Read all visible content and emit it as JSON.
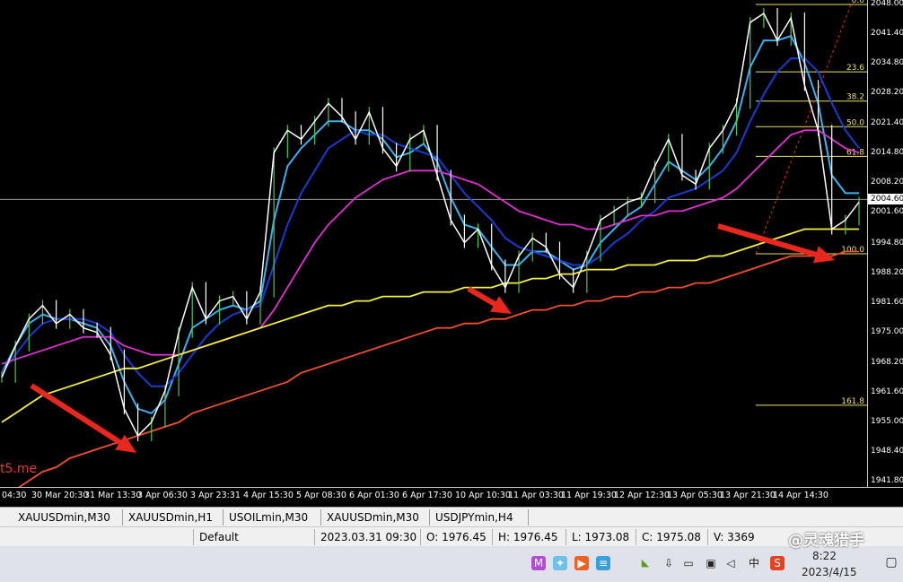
{
  "chart_data": {
    "type": "line",
    "symbol": "XAUUSDmin,M30",
    "price_ticks": [
      "2048.00",
      "2041.40",
      "2034.80",
      "2028.20",
      "2021.40",
      "2014.80",
      "2008.20",
      "2001.60",
      "1994.80",
      "1988.20",
      "1981.60",
      "1975.00",
      "1968.20",
      "1961.60",
      "1955.00",
      "1948.40",
      "1941.80"
    ],
    "current_price": "2004.60",
    "ylim": [
      1941.8,
      2048.0
    ],
    "time_ticks": [
      "04:30",
      "30 Mar 20:30",
      "31 Mar 13:30",
      "3 Apr 06:30",
      "3 Apr 23:31",
      "4 Apr 15:30",
      "5 Apr 08:30",
      "6 Apr 01:30",
      "6 Apr 17:30",
      "10 Apr 10:30",
      "11 Apr 03:30",
      "11 Apr 19:30",
      "12 Apr 12:30",
      "13 Apr 05:30",
      "13 Apr 21:30",
      "14 Apr 14:30"
    ],
    "fibonacci_levels": [
      {
        "label": "0.0",
        "price": 2048.0
      },
      {
        "label": "23.6",
        "price": 2033.0
      },
      {
        "label": "38.2",
        "price": 2026.5
      },
      {
        "label": "50.0",
        "price": 2020.8
      },
      {
        "label": "61.8",
        "price": 2014.2
      },
      {
        "label": "100.0",
        "price": 1992.5
      },
      {
        "label": "161.8",
        "price": 1958.8
      }
    ],
    "price_series": [
      1965,
      1972,
      1978,
      1981,
      1977,
      1979,
      1976,
      1975,
      1970,
      1958,
      1952,
      1955,
      1962,
      1975,
      1985,
      1978,
      1982,
      1983,
      1978,
      1984,
      2015,
      2020,
      2018,
      2022,
      2026,
      2023,
      2018,
      2024,
      2016,
      2012,
      2018,
      2020,
      2010,
      2000,
      1995,
      1998,
      1990,
      1985,
      1992,
      1996,
      1994,
      1988,
      1985,
      1992,
      2000,
      2002,
      2004,
      2005,
      2012,
      2018,
      2010,
      2008,
      2016,
      2020,
      2026,
      2044,
      2046,
      2040,
      2045,
      2030,
      2020,
      1998,
      2000,
      2004
    ],
    "ma_series": [
      {
        "color": "#3cb0f0",
        "values": [
          1966,
          1972,
          1977,
          1979,
          1978,
          1978,
          1977,
          1976,
          1972,
          1964,
          1958,
          1957,
          1960,
          1968,
          1976,
          1978,
          1980,
          1981,
          1980,
          1982,
          2000,
          2012,
          2016,
          2019,
          2022,
          2022,
          2020,
          2020,
          2018,
          2014,
          2015,
          2017,
          2013,
          2005,
          1999,
          1998,
          1994,
          1990,
          1990,
          1993,
          1993,
          1991,
          1989,
          1990,
          1995,
          1998,
          2001,
          2003,
          2008,
          2013,
          2011,
          2009,
          2012,
          2016,
          2022,
          2034,
          2040,
          2040,
          2041,
          2035,
          2026,
          2010,
          2006,
          2006
        ]
      },
      {
        "color": "#1a3ad0",
        "values": [
          1966,
          1970,
          1974,
          1977,
          1978,
          1978,
          1978,
          1977,
          1975,
          1970,
          1966,
          1963,
          1963,
          1966,
          1970,
          1974,
          1977,
          1979,
          1980,
          1981,
          1990,
          1999,
          2006,
          2011,
          2016,
          2018,
          2020,
          2019,
          2019,
          2017,
          2016,
          2015,
          2014,
          2010,
          2006,
          2003,
          2000,
          1996,
          1994,
          1993,
          1992,
          1991,
          1990,
          1990,
          1992,
          1995,
          1997,
          2000,
          2002,
          2005,
          2006,
          2007,
          2009,
          2011,
          2015,
          2022,
          2028,
          2033,
          2036,
          2036,
          2033,
          2026,
          2020,
          2016
        ]
      },
      {
        "color": "#e030d0",
        "values": [
          1968,
          1969,
          1970,
          1971,
          1972,
          1973,
          1974,
          1974,
          1974,
          1972,
          1971,
          1970,
          1970,
          1970,
          1971,
          1972,
          1973,
          1974,
          1975,
          1976,
          1980,
          1985,
          1990,
          1995,
          1999,
          2002,
          2005,
          2007,
          2009,
          2010,
          2011,
          2011,
          2011,
          2010,
          2009,
          2008,
          2006,
          2004,
          2002,
          2001,
          2000,
          1999,
          1999,
          1998,
          1998,
          1999,
          2000,
          2001,
          2001,
          2002,
          2002,
          2003,
          2004,
          2005,
          2007,
          2010,
          2013,
          2016,
          2019,
          2020,
          2020,
          2018,
          2016,
          2015
        ]
      },
      {
        "color": "#f5f046",
        "values": [
          1955,
          1957,
          1959,
          1961,
          1962,
          1963,
          1964,
          1965,
          1966,
          1967,
          1967,
          1968,
          1969,
          1970,
          1971,
          1972,
          1973,
          1974,
          1975,
          1976,
          1977,
          1978,
          1979,
          1980,
          1981,
          1981,
          1982,
          1982,
          1983,
          1983,
          1983,
          1984,
          1984,
          1984,
          1985,
          1985,
          1985,
          1986,
          1986,
          1987,
          1987,
          1988,
          1988,
          1989,
          1989,
          1989,
          1990,
          1990,
          1990,
          1991,
          1991,
          1991,
          1992,
          1992,
          1993,
          1994,
          1995,
          1996,
          1997,
          1998,
          1998,
          1998,
          1998,
          1998
        ]
      },
      {
        "color": "#f05030",
        "values": [
          1938,
          1940,
          1942,
          1944,
          1945,
          1947,
          1948,
          1949,
          1950,
          1951,
          1952,
          1953,
          1954,
          1955,
          1957,
          1958,
          1959,
          1960,
          1961,
          1962,
          1963,
          1964,
          1966,
          1967,
          1968,
          1969,
          1970,
          1971,
          1972,
          1973,
          1974,
          1975,
          1976,
          1976,
          1977,
          1977,
          1978,
          1978,
          1979,
          1980,
          1980,
          1981,
          1981,
          1982,
          1982,
          1983,
          1983,
          1984,
          1984,
          1985,
          1985,
          1986,
          1986,
          1987,
          1988,
          1989,
          1990,
          1991,
          1992,
          1992,
          1992,
          1992,
          1993,
          1993
        ]
      }
    ],
    "grid": false,
    "legend": "none"
  },
  "watermark": "t5.me",
  "tabs": [
    "XAUUSDmin,M30",
    "XAUUSDmin,H1",
    "USOILmin,M30",
    "XAUUSDmin,M30",
    "USDJPYmin,H4"
  ],
  "status": {
    "profile": "Default",
    "datetime": "2023.03.31 09:30",
    "open": "O: 1976.45",
    "high": "H: 1976.45",
    "low": "L: 1973.08",
    "close": "C: 1975.08",
    "volume": "V: 3369"
  },
  "taskbar": {
    "ime_lang": "中",
    "time": "8:22",
    "date": "2023/4/15"
  },
  "overlay_text": "@灵魂猎手",
  "colors": {
    "bull": "#4ec94e",
    "bear": "#ffffff",
    "arrow": "#e8281e",
    "fib": "#e8e068"
  }
}
